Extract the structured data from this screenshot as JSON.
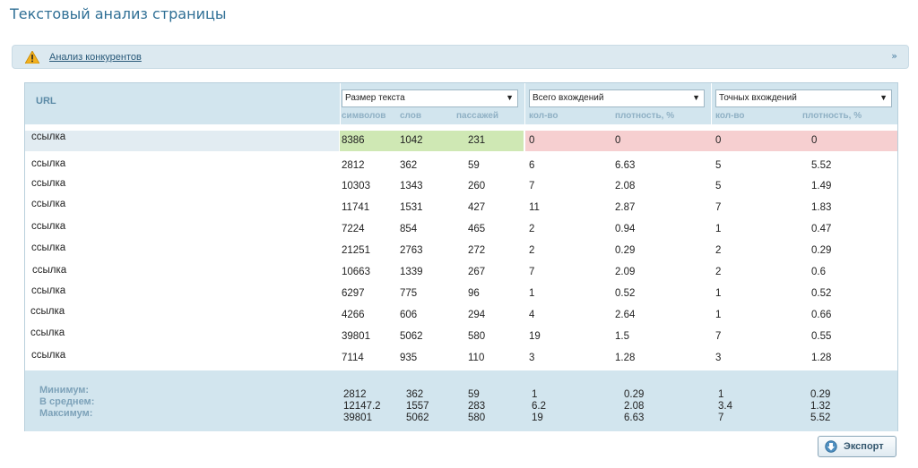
{
  "page": {
    "title": "Текстовый анализ страницы"
  },
  "competitors": {
    "label": "Анализ конкурентов",
    "icon": "warning-icon",
    "collapse_icon": "double-chevron-down-icon"
  },
  "table": {
    "url_header": "URL",
    "selects": [
      "Размер текста",
      "Всего вхождений",
      "Точных вхождений"
    ],
    "subheaders": [
      "символов",
      "слов",
      "пассажей",
      "кол-во",
      "плотность, %",
      "кол-во",
      "плотность, %"
    ],
    "rows": [
      {
        "url": "ссылка",
        "v": [
          "8386",
          "1042",
          "231",
          "0",
          "0",
          "0",
          "0"
        ]
      },
      {
        "url": "ссылка",
        "v": [
          "2812",
          "362",
          "59",
          "6",
          "6.63",
          "5",
          "5.52"
        ]
      },
      {
        "url": "ссылка",
        "v": [
          "10303",
          "1343",
          "260",
          "7",
          "2.08",
          "5",
          "1.49"
        ]
      },
      {
        "url": "ссылка",
        "v": [
          "11741",
          "1531",
          "427",
          "11",
          "2.87",
          "7",
          "1.83"
        ]
      },
      {
        "url": "ссылка",
        "v": [
          "7224",
          "854",
          "465",
          "2",
          "0.94",
          "1",
          "0.47"
        ]
      },
      {
        "url": "ссылка",
        "v": [
          "21251",
          "2763",
          "272",
          "2",
          "0.29",
          "2",
          "0.29"
        ]
      },
      {
        "url": "ссылка",
        "v": [
          "10663",
          "1339",
          "267",
          "7",
          "2.09",
          "2",
          "0.6"
        ]
      },
      {
        "url": "ссылка",
        "v": [
          "6297",
          "775",
          "96",
          "1",
          "0.52",
          "1",
          "0.52"
        ]
      },
      {
        "url": "ссылка",
        "v": [
          "4266",
          "606",
          "294",
          "4",
          "2.64",
          "1",
          "0.66"
        ]
      },
      {
        "url": "ссылка",
        "v": [
          "39801",
          "5062",
          "580",
          "19",
          "1.5",
          "7",
          "0.55"
        ]
      },
      {
        "url": "ссылка",
        "v": [
          "7114",
          "935",
          "110",
          "3",
          "1.28",
          "3",
          "1.28"
        ]
      }
    ],
    "summary": {
      "labels": [
        "Минимум:",
        "В среднем:",
        "Максимум:"
      ],
      "min": [
        "2812",
        "362",
        "59",
        "1",
        "0.29",
        "1",
        "0.29"
      ],
      "avg": [
        "12147.2",
        "1557",
        "283",
        "6.2",
        "2.08",
        "3.4",
        "1.32"
      ],
      "max": [
        "39801",
        "5062",
        "580",
        "19",
        "6.63",
        "7",
        "5.52"
      ]
    }
  },
  "export": {
    "label": "Экспорт",
    "icon": "export-arrow-icon"
  },
  "colors": {
    "title": "#2f6f95",
    "header_bg": "#d2e5ee",
    "highlight_green": "#cfe8b4",
    "highlight_red": "#f6cfd0"
  }
}
